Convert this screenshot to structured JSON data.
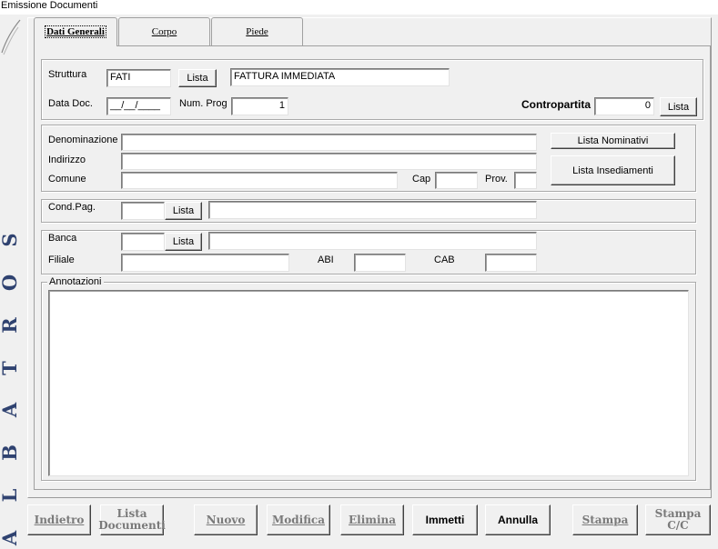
{
  "window": {
    "title": "Emissione Documenti"
  },
  "brand": {
    "letters": [
      "A",
      "L",
      "B",
      "A",
      "T",
      "R",
      "O",
      "S"
    ],
    "color": "#2f4270"
  },
  "tabs": [
    {
      "label": "Dati Generali",
      "active": true
    },
    {
      "label": "Corpo",
      "active": false
    },
    {
      "label": "Piede",
      "active": false
    }
  ],
  "header": {
    "struttura_label": "Struttura",
    "struttura_value": "FATI",
    "struttura_lista": "Lista",
    "struttura_desc": "FATTURA IMMEDIATA",
    "data_doc_label": "Data Doc.",
    "data_doc_value": "__/__/____",
    "num_prog_label": "Num. Prog",
    "num_prog_value": "1",
    "contropartita_label": "Contropartita",
    "contropartita_value": "0",
    "contropartita_lista": "Lista"
  },
  "anagrafica": {
    "denominazione_label": "Denominazione",
    "denominazione_value": "",
    "indirizzo_label": "Indirizzo",
    "indirizzo_value": "",
    "comune_label": "Comune",
    "comune_value": "",
    "cap_label": "Cap",
    "cap_value": "",
    "prov_label": "Prov.",
    "prov_value": "",
    "lista_nominativi": "Lista Nominativi",
    "lista_insediamenti": "Lista Insediamenti"
  },
  "pagamento": {
    "cond_pag_label": "Cond.Pag.",
    "cond_pag_code": "",
    "lista": "Lista",
    "cond_pag_desc": ""
  },
  "banca": {
    "banca_label": "Banca",
    "banca_code": "",
    "lista": "Lista",
    "banca_desc": "",
    "filiale_label": "Filiale",
    "filiale_value": "",
    "abi_label": "ABI",
    "abi_value": "",
    "cab_label": "CAB",
    "cab_value": ""
  },
  "annotazioni": {
    "label": "Annotazioni",
    "value": ""
  },
  "toolbar": {
    "indietro": "Indietro",
    "lista_documenti_1": "Lista",
    "lista_documenti_2": "Documenti",
    "nuovo": "Nuovo",
    "modifica": "Modifica",
    "elimina": "Elimina",
    "immetti": "Immetti",
    "annulla": "Annulla",
    "stampa": "Stampa",
    "stampa_cc_1": "Stampa",
    "stampa_cc_2": "C/C"
  }
}
